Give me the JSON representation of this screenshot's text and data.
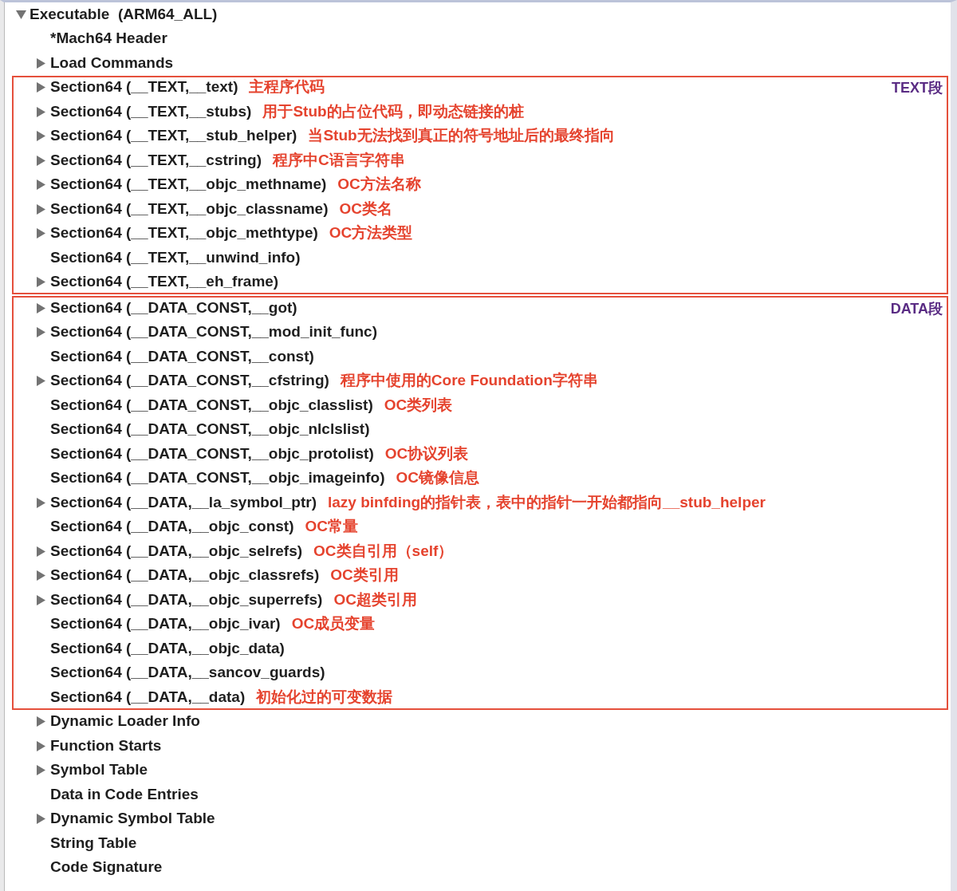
{
  "tree": {
    "kind": "branch",
    "label": "Executable  (ARM64_ALL)",
    "expanded": true,
    "children": [
      {
        "kind": "leaf",
        "label": "*Mach64 Header"
      },
      {
        "kind": "branch",
        "label": "Load Commands",
        "expanded": false
      },
      {
        "kind": "box",
        "tag": "TEXT段",
        "items": [
          {
            "kind": "branch",
            "label": "Section64 (__TEXT,__text)",
            "expanded": false,
            "note": "主程序代码"
          },
          {
            "kind": "branch",
            "label": "Section64 (__TEXT,__stubs)",
            "expanded": false,
            "note": "用于Stub的占位代码，即动态链接的桩"
          },
          {
            "kind": "branch",
            "label": "Section64 (__TEXT,__stub_helper)",
            "expanded": false,
            "note": "当Stub无法找到真正的符号地址后的最终指向"
          },
          {
            "kind": "branch",
            "label": "Section64 (__TEXT,__cstring)",
            "expanded": false,
            "note": "程序中C语言字符串"
          },
          {
            "kind": "branch",
            "label": "Section64 (__TEXT,__objc_methname)",
            "expanded": false,
            "note": "OC方法名称"
          },
          {
            "kind": "branch",
            "label": "Section64 (__TEXT,__objc_classname)",
            "expanded": false,
            "note": "OC类名"
          },
          {
            "kind": "branch",
            "label": "Section64 (__TEXT,__objc_methtype)",
            "expanded": false,
            "note": "OC方法类型"
          },
          {
            "kind": "leaf",
            "label": "Section64 (__TEXT,__unwind_info)"
          },
          {
            "kind": "branch",
            "label": "Section64 (__TEXT,__eh_frame)",
            "expanded": false
          }
        ]
      },
      {
        "kind": "box",
        "tag": "DATA段",
        "items": [
          {
            "kind": "branch",
            "label": "Section64 (__DATA_CONST,__got)",
            "expanded": false
          },
          {
            "kind": "branch",
            "label": "Section64 (__DATA_CONST,__mod_init_func)",
            "expanded": false
          },
          {
            "kind": "leaf",
            "label": "Section64 (__DATA_CONST,__const)"
          },
          {
            "kind": "branch",
            "label": "Section64 (__DATA_CONST,__cfstring)",
            "expanded": false,
            "note": "程序中使用的Core Foundation字符串"
          },
          {
            "kind": "leaf",
            "label": "Section64 (__DATA_CONST,__objc_classlist)",
            "note": "OC类列表"
          },
          {
            "kind": "leaf",
            "label": "Section64 (__DATA_CONST,__objc_nlclslist)"
          },
          {
            "kind": "leaf",
            "label": "Section64 (__DATA_CONST,__objc_protolist)",
            "note": "OC协议列表"
          },
          {
            "kind": "leaf",
            "label": "Section64 (__DATA_CONST,__objc_imageinfo)",
            "note": "OC镜像信息"
          },
          {
            "kind": "branch",
            "label": "Section64 (__DATA,__la_symbol_ptr)",
            "expanded": false,
            "note": "lazy binfding的指针表，表中的指针一开始都指向__stub_helper"
          },
          {
            "kind": "leaf",
            "label": "Section64 (__DATA,__objc_const)",
            "note": "OC常量"
          },
          {
            "kind": "branch",
            "label": "Section64 (__DATA,__objc_selrefs)",
            "expanded": false,
            "note": "OC类自引用（self）"
          },
          {
            "kind": "branch",
            "label": "Section64 (__DATA,__objc_classrefs)",
            "expanded": false,
            "note": "OC类引用"
          },
          {
            "kind": "branch",
            "label": "Section64 (__DATA,__objc_superrefs)",
            "expanded": false,
            "note": "OC超类引用"
          },
          {
            "kind": "leaf",
            "label": "Section64 (__DATA,__objc_ivar)",
            "note": "OC成员变量"
          },
          {
            "kind": "leaf",
            "label": "Section64 (__DATA,__objc_data)"
          },
          {
            "kind": "leaf",
            "label": "Section64 (__DATA,__sancov_guards)"
          },
          {
            "kind": "leaf",
            "label": "Section64 (__DATA,__data)",
            "note": "初始化过的可变数据"
          }
        ]
      },
      {
        "kind": "branch",
        "label": "Dynamic Loader Info",
        "expanded": false
      },
      {
        "kind": "branch",
        "label": "Function Starts",
        "expanded": false
      },
      {
        "kind": "branch",
        "label": "Symbol Table",
        "expanded": false
      },
      {
        "kind": "leaf",
        "label": "Data in Code Entries"
      },
      {
        "kind": "branch",
        "label": "Dynamic Symbol Table",
        "expanded": false
      },
      {
        "kind": "leaf",
        "label": "String Table"
      },
      {
        "kind": "leaf",
        "label": "Code Signature"
      }
    ]
  }
}
